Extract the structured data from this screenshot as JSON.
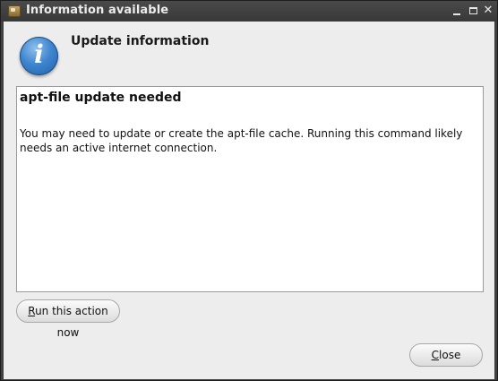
{
  "window": {
    "title": "Information available"
  },
  "dialog": {
    "heading": "Update information",
    "icon": "information-icon"
  },
  "message": {
    "title": "apt-file update needed",
    "body": "You may need to update or create the apt-file cache. Running this command likely needs an active internet connection."
  },
  "buttons": {
    "run_action_mnemonic": "R",
    "run_action_rest": "un this action now",
    "close_mnemonic": "C",
    "close_rest": "lose"
  }
}
